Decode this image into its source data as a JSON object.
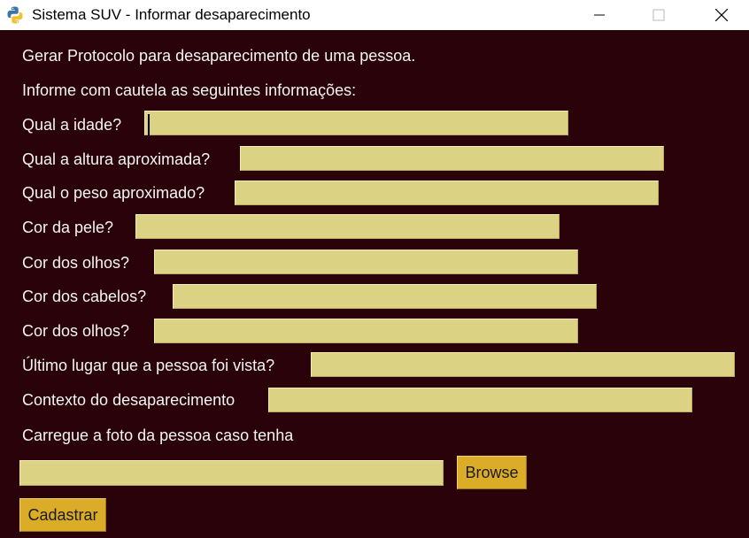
{
  "window": {
    "title": "Sistema SUV - Informar desaparecimento",
    "app_icon": "python-icon"
  },
  "colors": {
    "background": "#290309",
    "field": "#dcd284",
    "button": "#dbac28",
    "text": "#f4f4f4"
  },
  "form": {
    "header": "Gerar Protocolo para desaparecimento de uma pessoa.",
    "instruction": "Informe com cautela as seguintes informações:",
    "fields": [
      {
        "label": "Qual a idade?",
        "value": ""
      },
      {
        "label": "Qual a altura aproximada?",
        "value": ""
      },
      {
        "label": "Qual o peso aproximado?",
        "value": ""
      },
      {
        "label": "Cor da pele?",
        "value": ""
      },
      {
        "label": "Cor dos olhos?",
        "value": ""
      },
      {
        "label": "Cor dos cabelos?",
        "value": ""
      },
      {
        "label": "Cor dos olhos?",
        "value": ""
      },
      {
        "label": "Último lugar que a pessoa foi vista?",
        "value": ""
      },
      {
        "label": "Contexto do desaparecimento",
        "value": ""
      }
    ],
    "photo_label": "Carregue a foto da pessoa caso tenha",
    "photo_path": "",
    "browse_label": "Browse",
    "submit_label": "Cadastrar"
  }
}
